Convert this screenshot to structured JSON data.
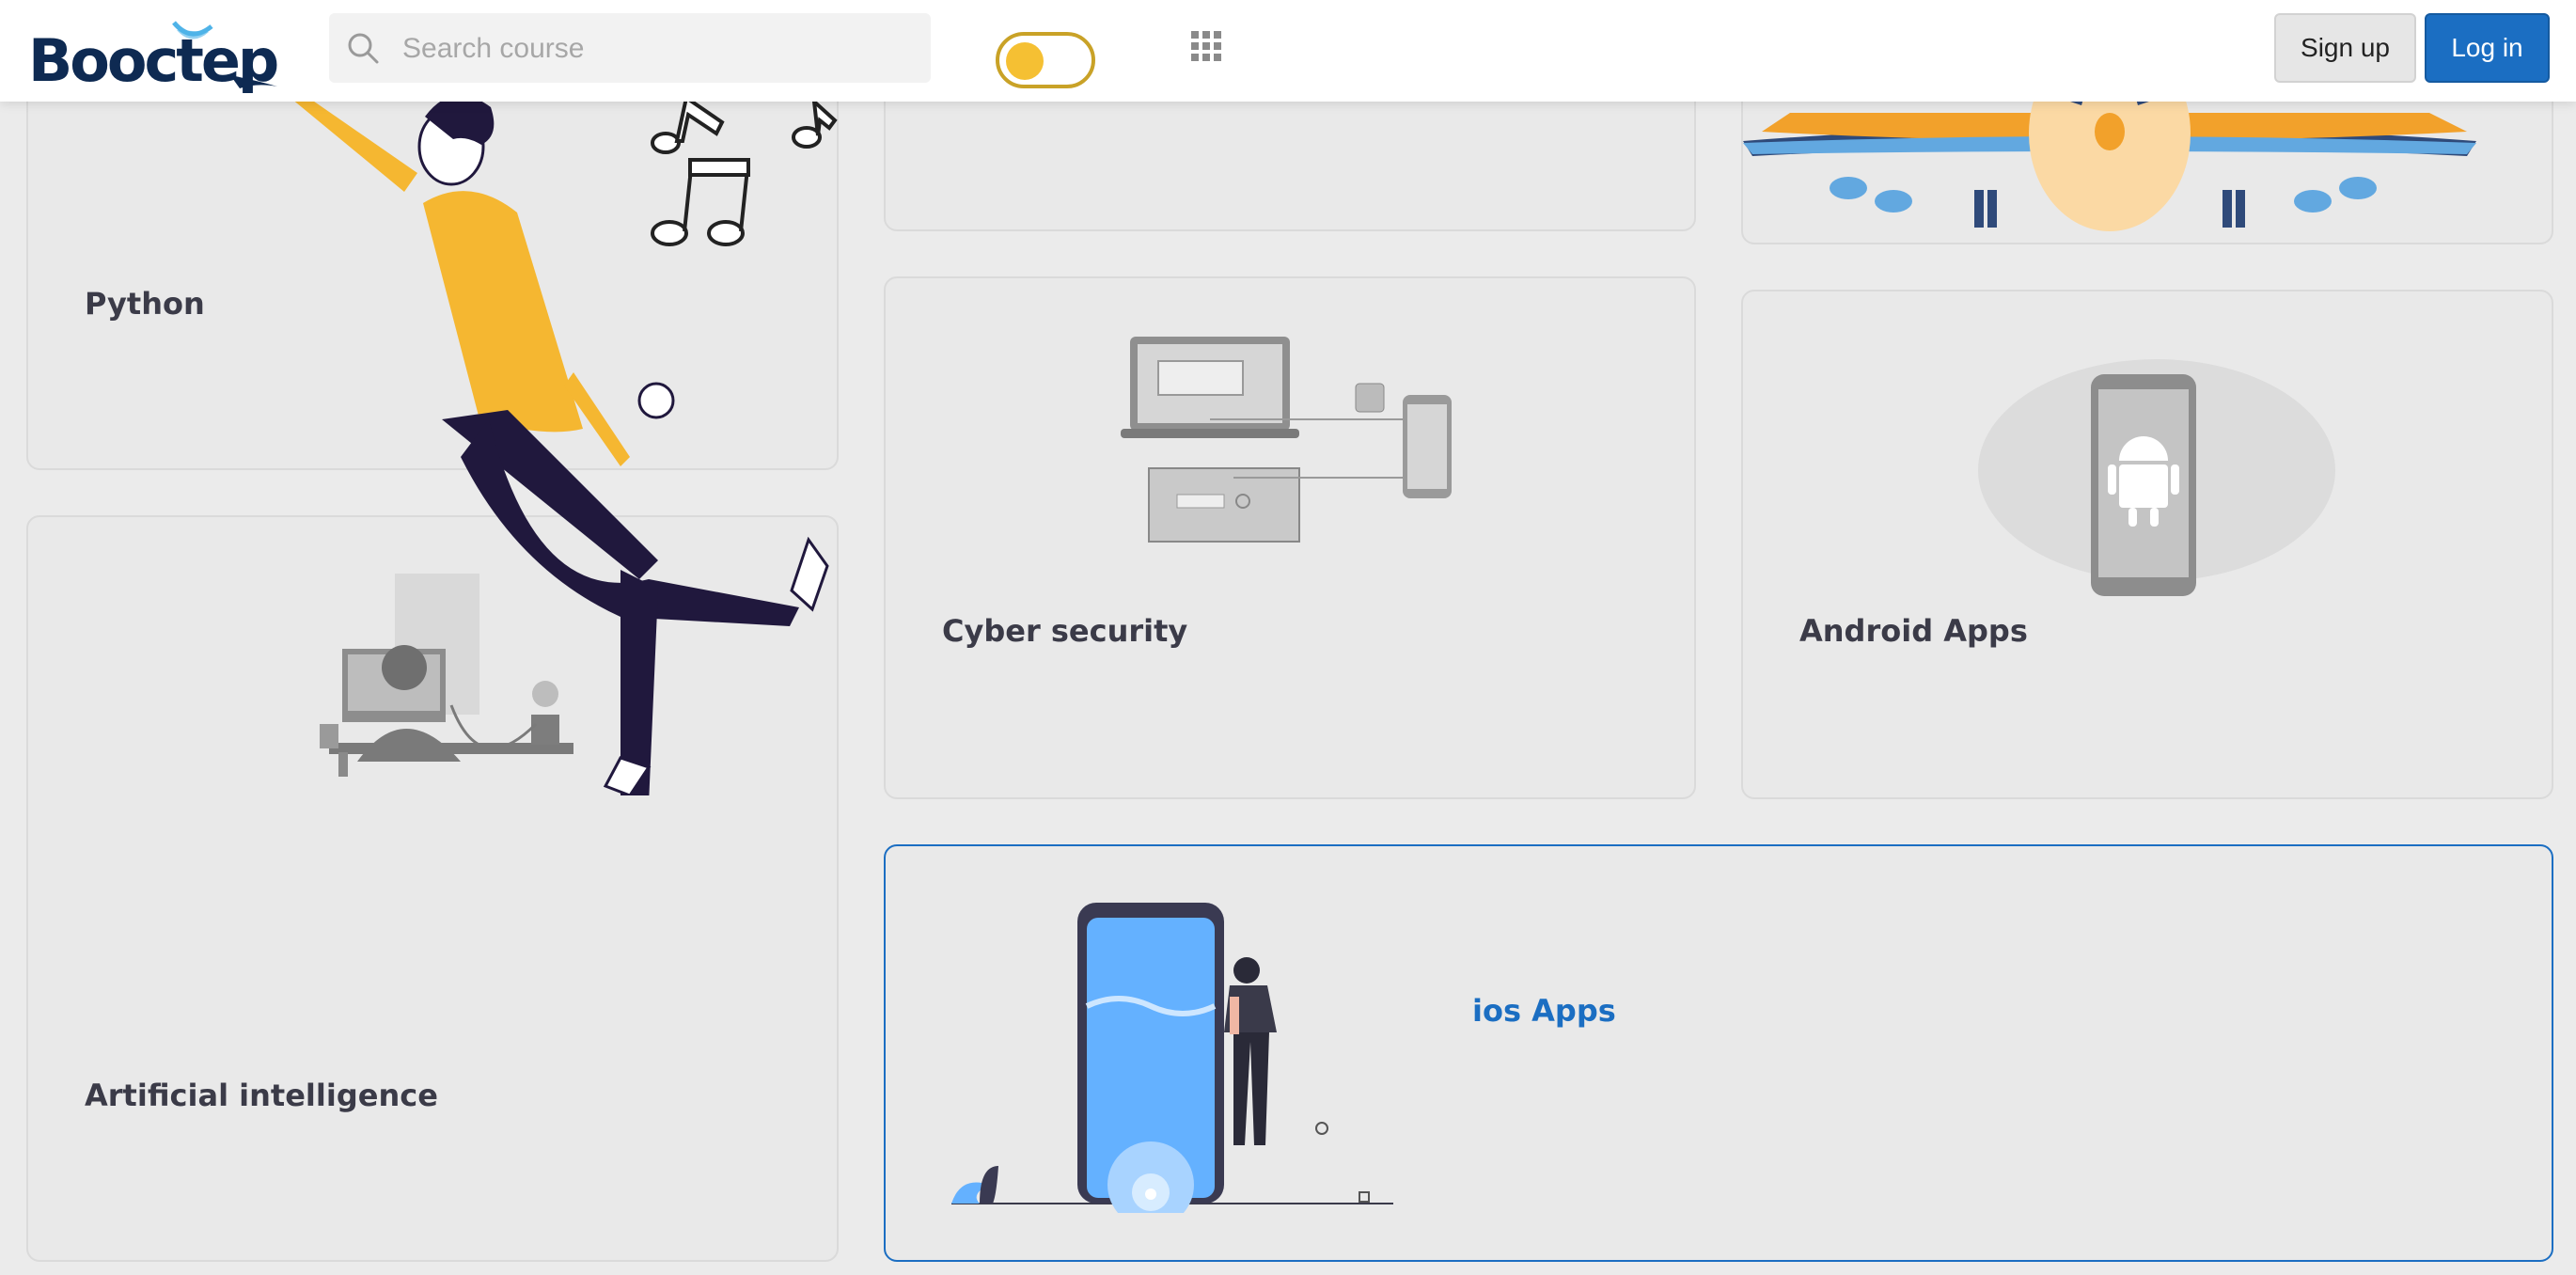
{
  "brand": {
    "logo_text": "Booctep"
  },
  "search": {
    "placeholder": "Search course",
    "value": ""
  },
  "header": {
    "theme_toggle_state": "on",
    "signup_label": "Sign up",
    "login_label": "Log in"
  },
  "courses": [
    {
      "title": "Python"
    },
    {
      "title": "Artificial intelligence"
    },
    {
      "title": "Cyber security"
    },
    {
      "title": "Android Apps"
    },
    {
      "title": "ios Apps"
    }
  ],
  "colors": {
    "accent": "#1b6ec2",
    "toggle_knob": "#f5c033",
    "navy": "#0e2a52",
    "card_bg": "#e9e9e9"
  },
  "icons": [
    "search-icon",
    "apps-grid-icon",
    "music-notes-icon",
    "airplane-icon",
    "android-icon"
  ]
}
